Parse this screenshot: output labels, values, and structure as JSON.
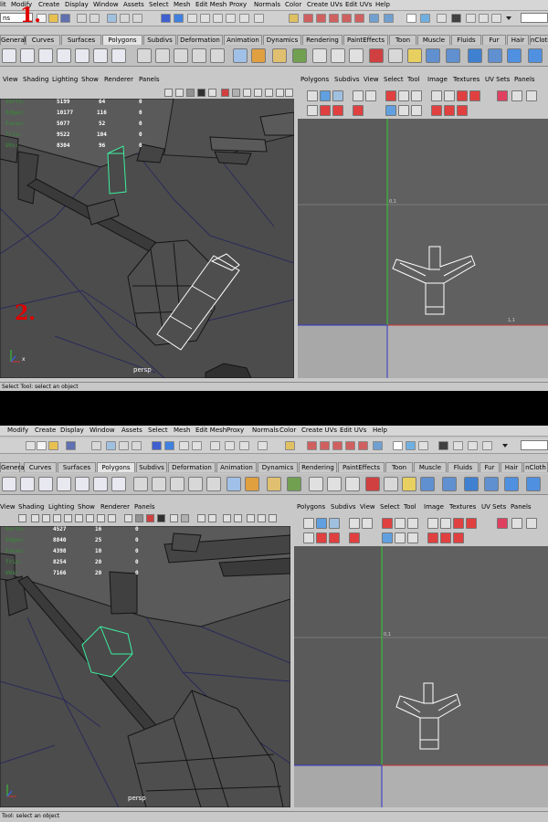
{
  "annotations": {
    "one": "1.",
    "two": "2."
  },
  "menubar_top": [
    "lit",
    "Modify",
    "Create",
    "Display",
    "Window",
    "Assets",
    "Select",
    "Mesh",
    "Edit Mesh",
    "Proxy",
    "Normals",
    "Color",
    "Create UVs",
    "Edit UVs",
    "Help"
  ],
  "menubar_bottom": [
    "Modify",
    "Create",
    "Display",
    "Window",
    "Assets",
    "Select",
    "Mesh",
    "Edit Mesh",
    "Proxy",
    "Normals",
    "Color",
    "Create UVs",
    "Edit UVs",
    "Help"
  ],
  "mode_select_value": "ns",
  "shelf_tabs": [
    "General",
    "Curves",
    "Surfaces",
    "Polygons",
    "Subdivs",
    "Deformation",
    "Animation",
    "Dynamics",
    "Rendering",
    "PaintEffects",
    "Toon",
    "Muscle",
    "Fluids",
    "Fur",
    "Hair",
    "nCloth"
  ],
  "viewport_menu": [
    "View",
    "Shading",
    "Lighting",
    "Show",
    "Renderer",
    "Panels"
  ],
  "uv_menu": [
    "Polygons",
    "Subdivs",
    "View",
    "Select",
    "Tool",
    "Image",
    "Textures",
    "UV Sets",
    "Panels"
  ],
  "hud_labels": [
    "Verts:",
    "Edges:",
    "Faces:",
    "Tris:",
    "UVs:"
  ],
  "hud_top": [
    [
      "5199",
      "64",
      "0"
    ],
    [
      "10177",
      "116",
      "0"
    ],
    [
      "5077",
      "52",
      "0"
    ],
    [
      "9522",
      "104",
      "0"
    ],
    [
      "8304",
      "96",
      "0"
    ]
  ],
  "hud_bottom": [
    [
      "4527",
      "16",
      "0"
    ],
    [
      "8840",
      "25",
      "0"
    ],
    [
      "4398",
      "10",
      "0"
    ],
    [
      "8254",
      "20",
      "0"
    ],
    [
      "7166",
      "20",
      "0"
    ]
  ],
  "camera_label": "persp",
  "axis_label": "x",
  "uv_label_top": "0,1",
  "uv_label_right": "1,1",
  "help_text": "Select Tool: select an object",
  "help_text_bottom": "Tool: select an object",
  "colors": {
    "viewport_bg": "#505050",
    "wire": "#1a1a1a",
    "selected": "#3cf0a0",
    "uv_green_axis": "#33cc33",
    "uv_red_axis": "#cc3333",
    "uv_blue_axis": "#3333cc"
  }
}
